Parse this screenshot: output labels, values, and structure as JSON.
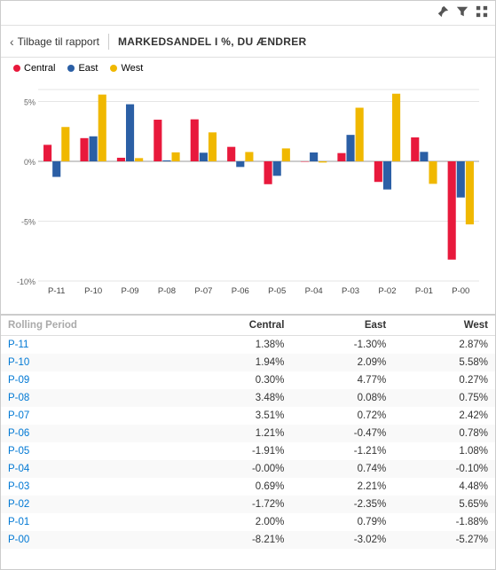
{
  "toolbar": {
    "pin_icon": "📌",
    "filter_icon": "⊲",
    "more_icon": "⊞"
  },
  "header": {
    "back_label": "Tilbage til rapport",
    "title": "MARKEDSANDEL I %, DU ÆNDRER"
  },
  "legend": {
    "items": [
      {
        "id": "central",
        "label": "Central",
        "color": "#e8193c"
      },
      {
        "id": "east",
        "label": "East",
        "color": "#2b5fa5"
      },
      {
        "id": "west",
        "label": "West",
        "color": "#f0b800"
      }
    ]
  },
  "chart": {
    "y_labels": [
      "5%",
      "0%",
      "-5%",
      "-10%"
    ],
    "x_labels": [
      "P-11",
      "P-10",
      "P-09",
      "P-08",
      "P-07",
      "P-06",
      "P-05",
      "P-04",
      "P-03",
      "P-02",
      "P-01",
      "P-00"
    ],
    "colors": {
      "central": "#e8193c",
      "east": "#2b5fa5",
      "west": "#f0b800"
    },
    "data": [
      {
        "period": "P-11",
        "central": 1.38,
        "east": -1.3,
        "west": 2.87
      },
      {
        "period": "P-10",
        "central": 1.94,
        "east": 2.09,
        "west": 5.58
      },
      {
        "period": "P-09",
        "central": 0.3,
        "east": 4.77,
        "west": 0.27
      },
      {
        "period": "P-08",
        "central": 3.48,
        "east": 0.08,
        "west": 0.75
      },
      {
        "period": "P-07",
        "central": 3.51,
        "east": 0.72,
        "west": 2.42
      },
      {
        "period": "P-06",
        "central": 1.21,
        "east": -0.47,
        "west": 0.78
      },
      {
        "period": "P-05",
        "central": -1.91,
        "east": -1.21,
        "west": 1.08
      },
      {
        "period": "P-04",
        "central": -0.0,
        "east": 0.74,
        "west": -0.1
      },
      {
        "period": "P-03",
        "central": 0.69,
        "east": 2.21,
        "west": 4.48
      },
      {
        "period": "P-02",
        "central": -1.72,
        "east": -2.35,
        "west": 5.65
      },
      {
        "period": "P-01",
        "central": 2.0,
        "east": 0.79,
        "west": -1.88
      },
      {
        "period": "P-00",
        "central": -8.21,
        "east": -3.02,
        "west": -5.27
      }
    ]
  },
  "table": {
    "columns": [
      "Rolling Period",
      "Central",
      "East",
      "West"
    ],
    "rows": [
      {
        "period": "P-11",
        "central": "1.38%",
        "east": "-1.30%",
        "west": "2.87%"
      },
      {
        "period": "P-10",
        "central": "1.94%",
        "east": "2.09%",
        "west": "5.58%"
      },
      {
        "period": "P-09",
        "central": "0.30%",
        "east": "4.77%",
        "west": "0.27%"
      },
      {
        "period": "P-08",
        "central": "3.48%",
        "east": "0.08%",
        "west": "0.75%"
      },
      {
        "period": "P-07",
        "central": "3.51%",
        "east": "0.72%",
        "west": "2.42%"
      },
      {
        "period": "P-06",
        "central": "1.21%",
        "east": "-0.47%",
        "west": "0.78%"
      },
      {
        "period": "P-05",
        "central": "-1.91%",
        "east": "-1.21%",
        "west": "1.08%"
      },
      {
        "period": "P-04",
        "central": "-0.00%",
        "east": "0.74%",
        "west": "-0.10%"
      },
      {
        "period": "P-03",
        "central": "0.69%",
        "east": "2.21%",
        "west": "4.48%"
      },
      {
        "period": "P-02",
        "central": "-1.72%",
        "east": "-2.35%",
        "west": "5.65%"
      },
      {
        "period": "P-01",
        "central": "2.00%",
        "east": "0.79%",
        "west": "-1.88%"
      },
      {
        "period": "P-00",
        "central": "-8.21%",
        "east": "-3.02%",
        "west": "-5.27%"
      }
    ]
  }
}
